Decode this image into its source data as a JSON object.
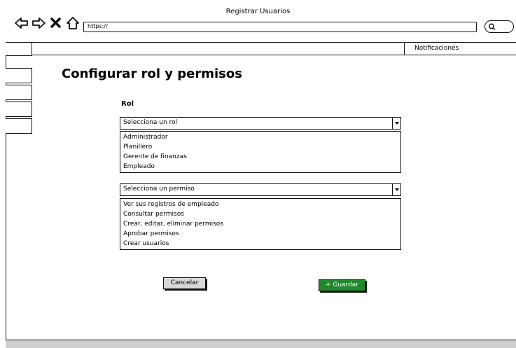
{
  "window": {
    "title": "Registrar Usuarios"
  },
  "browser": {
    "url": "https://"
  },
  "header": {
    "notifications_label": "Notificaciones"
  },
  "page": {
    "title": "Configurar rol y permisos"
  },
  "role": {
    "label": "Rol",
    "placeholder": "Selecciona un rol",
    "options": [
      "Administrador",
      "Planillero",
      "Gerente de finanzas",
      "Empleado"
    ]
  },
  "permission": {
    "placeholder": "Selecciona un permiso",
    "options": [
      "Ver sus registros de empleado",
      "Consultar permisos",
      "Crear, editar, eliminar permisos",
      "Aprobar permisos",
      "Crear usuarios"
    ]
  },
  "actions": {
    "cancel_label": "Cancelar",
    "save_label": "+ Guardar"
  },
  "colors": {
    "save_button": "#1e8a2a",
    "cancel_button": "#d8d8d8"
  }
}
